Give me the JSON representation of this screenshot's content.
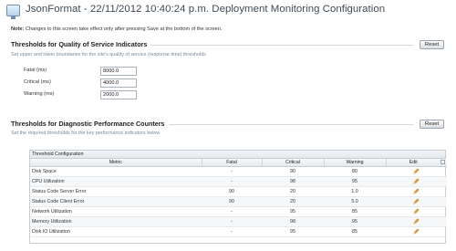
{
  "header": {
    "icon": "monitor-icon",
    "title": "JsonFormat - 22/11/2012 10:40:24 p.m. Deployment Monitoring Configuration"
  },
  "note": {
    "label": "Note:",
    "text": "Changes to this screen take effect only after pressing Save at the bottom of the screen."
  },
  "qos": {
    "title": "Thresholds for Quality of Service Indicators",
    "description": "Set upper and lower boundaries for the site's quality of service (response time) thresholds",
    "reset_label": "Reset",
    "fields": [
      {
        "label": "Fatal (ms)",
        "value": "8000.0"
      },
      {
        "label": "Critical (ms)",
        "value": "4000.0"
      },
      {
        "label": "Warning (ms)",
        "value": "2000.0"
      }
    ]
  },
  "diag": {
    "title": "Thresholds for Diagnostic Performance Counters",
    "description": "Set the required thresholds for the key performance indicators below",
    "reset_label": "Reset",
    "table": {
      "caption": "Threshold Configuration",
      "columns": [
        "Metric",
        "Fatal",
        "Critical",
        "Warning",
        "Edit"
      ],
      "rows": [
        {
          "metric": "Disk Space",
          "fatal": "-",
          "critical": "90",
          "warning": "80"
        },
        {
          "metric": "CPU Utilization",
          "fatal": "-",
          "critical": "98",
          "warning": "95"
        },
        {
          "metric": "Status Code Server Error",
          "fatal": "90",
          "critical": "20",
          "warning": "1.0"
        },
        {
          "metric": "Status Code Client Error",
          "fatal": "90",
          "critical": "20",
          "warning": "5.0"
        },
        {
          "metric": "Network Utilization",
          "fatal": "-",
          "critical": "95",
          "warning": "85"
        },
        {
          "metric": "Memory Utilization",
          "fatal": "-",
          "critical": "98",
          "warning": "95"
        },
        {
          "metric": "Disk IO Utilization",
          "fatal": "-",
          "critical": "95",
          "warning": "85"
        }
      ]
    }
  },
  "colors": {
    "section_rule": "#d9d9d9",
    "description": "#7b8a96",
    "pencil": "#e6a13a"
  }
}
